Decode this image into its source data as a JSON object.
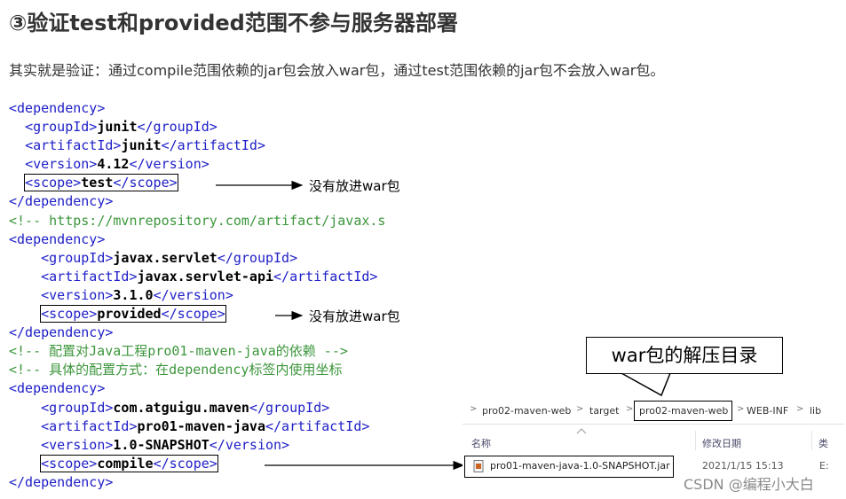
{
  "heading": "③验证test和provided范围不参与服务器部署",
  "paragraph": "其实就是验证：通过compile范围依赖的jar包会放入war包，通过test范围依赖的jar包不会放入war包。",
  "code": {
    "d1_open": "<dependency>",
    "d1_groupId_open": "<groupId>",
    "d1_groupId_val": "junit",
    "d1_groupId_close": "</groupId>",
    "d1_artifactId_open": "<artifactId>",
    "d1_artifactId_val": "junit",
    "d1_artifactId_close": "</artifactId>",
    "d1_version_open": "<version>",
    "d1_version_val": "4.12",
    "d1_version_close": "</version>",
    "d1_scope_open": "<scope>",
    "d1_scope_val": "test",
    "d1_scope_close": "</scope>",
    "d1_close": "</dependency>",
    "comment1": "<!-- https://mvnrepository.com/artifact/javax.s",
    "d2_open": "<dependency>",
    "d2_groupId_open": "<groupId>",
    "d2_groupId_val": "javax.servlet",
    "d2_groupId_close": "</groupId>",
    "d2_artifactId_open": "<artifactId>",
    "d2_artifactId_val": "javax.servlet-api",
    "d2_artifactId_close": "</artifactId>",
    "d2_version_open": "<version>",
    "d2_version_val": "3.1.0",
    "d2_version_close": "</version>",
    "d2_scope_open": "<scope>",
    "d2_scope_val": "provided",
    "d2_scope_close": "</scope>",
    "d2_close": "</dependency>",
    "comment2": "<!-- 配置对Java工程pro01-maven-java的依赖 -->",
    "comment3": "<!-- 具体的配置方式：在dependency标签内使用坐标",
    "d3_open": "<dependency>",
    "d3_groupId_open": "<groupId>",
    "d3_groupId_val": "com.atguigu.maven",
    "d3_groupId_close": "</groupId>",
    "d3_artifactId_open": "<artifactId>",
    "d3_artifactId_val": "pro01-maven-java",
    "d3_artifactId_close": "</artifactId>",
    "d3_version_open": "<version>",
    "d3_version_val": "1.0-SNAPSHOT",
    "d3_version_close": "</version>",
    "d3_scope_open": "<scope>",
    "d3_scope_val": "compile",
    "d3_scope_close": "</scope>",
    "d3_close": "</dependency>"
  },
  "annotations": {
    "test_note": "没有放进war包",
    "provided_note": "没有放进war包",
    "callout": "war包的解压目录"
  },
  "explorer": {
    "breadcrumbs": [
      "pro02-maven-web",
      "target",
      "pro02-maven-web",
      "WEB-INF",
      "lib"
    ],
    "separator": ">",
    "col_name": "名称",
    "col_date": "修改日期",
    "col_type": "类",
    "file_name": "pro01-maven-java-1.0-SNAPSHOT.jar",
    "file_date": "2021/1/15 15:13",
    "file_type": "E:"
  },
  "watermark": "CSDN @编程小大白"
}
